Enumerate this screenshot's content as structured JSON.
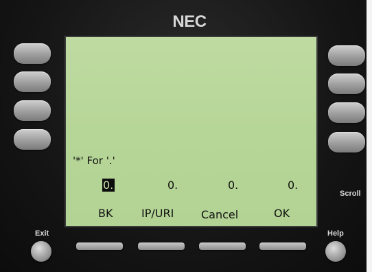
{
  "brand": "NEC",
  "display": {
    "hint": "'*' For '.'",
    "ip_fields": [
      "0.",
      "0.",
      "0.",
      "0."
    ],
    "softkeys": [
      "BK",
      "IP/URI",
      "Cancel",
      "OK"
    ]
  },
  "buttons": {
    "exit_label": "Exit",
    "help_label": "Help",
    "scroll_label": "Scroll"
  }
}
